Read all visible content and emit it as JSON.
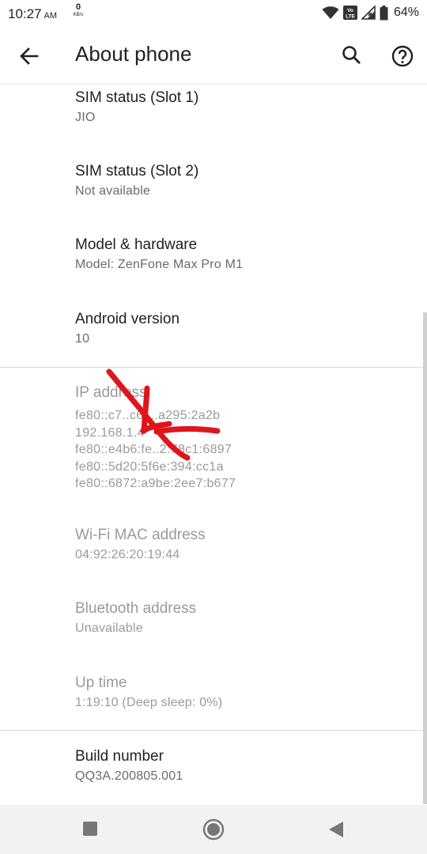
{
  "status_bar": {
    "time": "10:27",
    "ampm": "AM",
    "net_speed_value": "0",
    "net_speed_unit": "KB/s",
    "volte_label": "Vo LTE",
    "battery_percent": "64%",
    "icons": [
      "wifi-icon",
      "volte-icon",
      "signal-icon",
      "battery-icon"
    ]
  },
  "app_bar": {
    "title": "About phone",
    "icons": [
      "back-arrow-icon",
      "search-icon",
      "help-icon"
    ]
  },
  "items": [
    {
      "title": "SIM status (Slot 1)",
      "summary": "JIO"
    },
    {
      "title": "SIM status (Slot 2)",
      "summary": "Not available"
    },
    {
      "title": "Model & hardware",
      "summary": "Model: ZenFone Max Pro M1"
    },
    {
      "title": "Android version",
      "summary": "10"
    },
    {
      "title": "IP address",
      "lines": [
        "fe80::c7..c61..a295:2a2b",
        "192.168.1.4",
        "fe80::e4b6:fe..2:78c1:6897",
        "fe80::5d20:5f6e:394:cc1a",
        "fe80::6872:a9be:2ee7:b677"
      ]
    },
    {
      "title": "Wi-Fi MAC address",
      "summary": "04:92:26:20:19:44"
    },
    {
      "title": "Bluetooth address",
      "summary": "Unavailable"
    },
    {
      "title": "Up time",
      "summary": "1:19:10 (Deep sleep: 0%)"
    },
    {
      "title": "Build number",
      "summary": "QQ3A.200805.001"
    }
  ],
  "annotation": {
    "color": "#e0141b",
    "shape": "hand-drawn-arrow"
  },
  "nav_bar": {
    "icons": [
      "recents-icon",
      "home-icon",
      "back-icon"
    ]
  }
}
